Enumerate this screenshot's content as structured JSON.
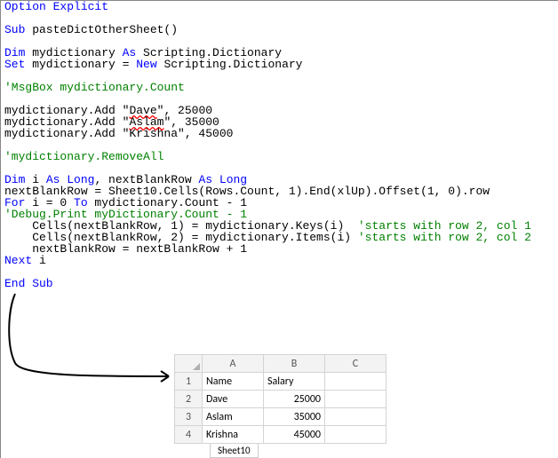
{
  "code": {
    "optExplicit1": "Option",
    "optExplicit2": " Explicit",
    "subKw": "Sub",
    "subName": " pasteDictOtherSheet()",
    "dim1a": "Dim",
    "dim1b": " mydictionary ",
    "asKw": "As",
    "dim1c": " Scripting.Dictionary",
    "set1a": "Set",
    "set1b": " mydictionary = ",
    "newKw": "New",
    "set1c": " Scripting.Dictionary",
    "cmtMsg": "'MsgBox mydictionary.Count",
    "add1a": "mydictionary.Add \"",
    "add1name": "Dave",
    "add1b": "\", 25000",
    "add2a": "mydictionary.Add \"",
    "add2name": "Aslam",
    "add2b": "\", 35000",
    "add3": "mydictionary.Add \"Krishna\", 45000",
    "cmtRemove": "'mydictionary.RemoveAll",
    "dim2a": "Dim",
    "dim2b": " i ",
    "dim2c": " ",
    "longKw": "Long",
    "dim2d": ", nextBlankRow ",
    "nbr": "nextBlankRow = Sheet10.Cells(Rows.Count, 1).End(xlUp).Offset(1, 0).row",
    "forKw": "For",
    "forBody": " i = 0 ",
    "toKw": "To",
    "forBody2": " mydictionary.Count - 1",
    "cmtDbg": "'Debug.Print myDictionary.Count - 1",
    "cells1": "    Cells(nextBlankRow, 1) = mydictionary.Keys(i)  ",
    "cmtCells1": "'starts with row 2, col 1",
    "cells2": "    Cells(nextBlankRow, 2) = mydictionary.Items(i) ",
    "cmtCells2": "'starts with row 2, col 2",
    "incr": "    nextBlankRow = nextBlankRow + 1",
    "nextKw": "Next",
    "nextBody": " i",
    "endSub": "End Sub"
  },
  "sheet": {
    "tabName": "Sheet10",
    "cols": [
      "A",
      "B",
      "C"
    ],
    "rows": [
      "1",
      "2",
      "3",
      "4"
    ],
    "header": {
      "a": "Name",
      "b": "Salary"
    },
    "data": [
      {
        "a": "Dave",
        "b": "25000"
      },
      {
        "a": "Aslam",
        "b": "35000"
      },
      {
        "a": "Krishna",
        "b": "45000"
      }
    ]
  }
}
